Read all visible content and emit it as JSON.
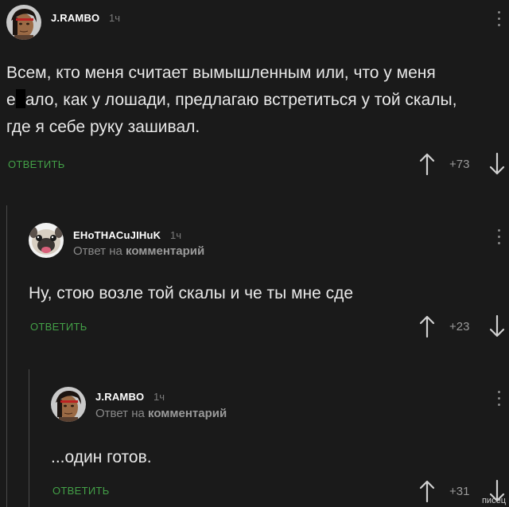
{
  "comments": [
    {
      "username": "J.RAMBO",
      "time": "1ч",
      "text_line1": "Всем, кто меня считает вымышленным или, что у меня",
      "text_line2_pre": "е",
      "text_line2_post": "ало, как у лошади, предлагаю встретиться у той скалы,",
      "text_line3": "где я себе руку зашивал.",
      "reply_label": "ОТВЕТИТЬ",
      "score": "+73"
    },
    {
      "username": "EHoTHACuJIHuK",
      "time": "1ч",
      "reply_prefix": "Ответ на ",
      "reply_target": "комментарий",
      "text": "Ну, стою возле той скалы и че ты мне сде",
      "reply_label": "ОТВЕТИТЬ",
      "score": "+23"
    },
    {
      "username": "J.RAMBO",
      "time": "1ч",
      "reply_prefix": "Ответ на ",
      "reply_target": "комментарий",
      "text": "...один готов.",
      "reply_label": "ОТВЕТИТЬ",
      "score": "+31"
    }
  ],
  "watermark": "писец",
  "colors": {
    "background": "#1a1a1a",
    "reply_green": "#43a047",
    "muted": "#7a7a7a"
  },
  "icons": [
    "rambo-avatar",
    "pug-avatar",
    "arrow-up-icon",
    "arrow-down-icon",
    "more-vertical-icon"
  ]
}
